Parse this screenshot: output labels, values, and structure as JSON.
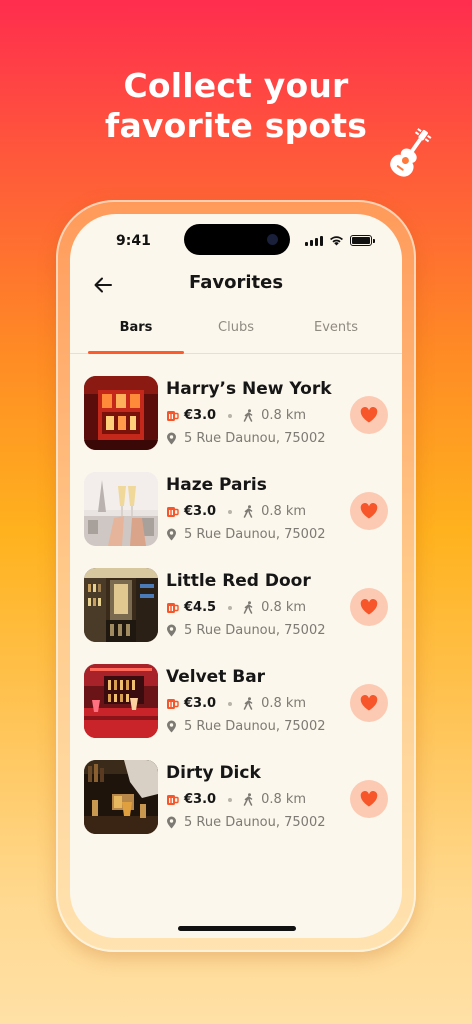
{
  "headline": {
    "line1": "Collect your",
    "line2": "favorite spots"
  },
  "status_bar": {
    "time": "9:41"
  },
  "nav": {
    "title": "Favorites"
  },
  "tabs": [
    {
      "label": "Bars",
      "active": true
    },
    {
      "label": "Clubs",
      "active": false
    },
    {
      "label": "Events",
      "active": false
    }
  ],
  "favorites": [
    {
      "name": "Harry’s New York",
      "price": "€3.0",
      "distance": "0.8 km",
      "address": "5 Rue Daunou, 75002"
    },
    {
      "name": "Haze Paris",
      "price": "€3.0",
      "distance": "0.8 km",
      "address": "5 Rue Daunou, 75002"
    },
    {
      "name": "Little Red Door",
      "price": "€4.5",
      "distance": "0.8 km",
      "address": "5 Rue Daunou, 75002"
    },
    {
      "name": "Velvet Bar",
      "price": "€3.0",
      "distance": "0.8 km",
      "address": "5 Rue Daunou, 75002"
    },
    {
      "name": "Dirty Dick",
      "price": "€3.0",
      "distance": "0.8 km",
      "address": "5 Rue Daunou, 75002"
    }
  ],
  "icons": {
    "decoration": "guitar-icon",
    "back": "arrow-left-icon",
    "price": "beer-mug-icon",
    "distance": "walking-person-icon",
    "address": "map-pin-icon",
    "favorite": "heart-icon"
  },
  "colors": {
    "accent": "#ff5a2c",
    "heart": "#f7562a",
    "heart_bg": "#fccab3",
    "screen_bg": "#fcf7ec"
  }
}
